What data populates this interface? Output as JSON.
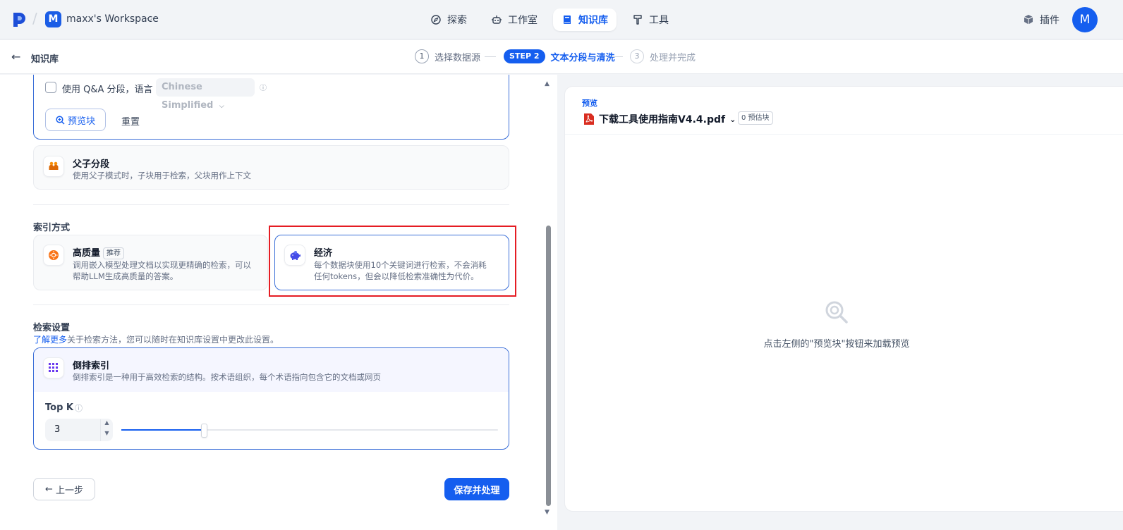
{
  "topnav": {
    "workspace_avatar": "M",
    "workspace_name": "maxx's Workspace",
    "tabs": [
      {
        "label": "探索",
        "icon": "compass-icon"
      },
      {
        "label": "工作室",
        "icon": "robot-icon"
      },
      {
        "label": "知识库",
        "icon": "book-icon",
        "active": true
      },
      {
        "label": "工具",
        "icon": "hammer-icon"
      }
    ],
    "plugin_label": "插件",
    "user_avatar": "M"
  },
  "subheader": {
    "back_label": "知识库",
    "steps": [
      {
        "num": "1",
        "label": "选择数据源",
        "state": "done"
      },
      {
        "num": "STEP 2",
        "label": "文本分段与清洗",
        "state": "current"
      },
      {
        "num": "3",
        "label": "处理并完成",
        "state": "todo"
      }
    ]
  },
  "segmentation": {
    "qa_label": "使用 Q&A 分段，语言",
    "qa_language": "Chinese Simplified",
    "preview_button": "预览块",
    "reset_button": "重置",
    "parent_child": {
      "title": "父子分段",
      "desc": "使用父子模式时，子块用于检索，父块用作上下文"
    }
  },
  "index": {
    "section_title": "索引方式",
    "high_quality": {
      "title": "高质量",
      "badge": "推荐",
      "desc_line1": "调用嵌入模型处理文档以实现更精确的检索，可以",
      "desc_line2": "帮助LLM生成高质量的答案。"
    },
    "economy": {
      "title": "经济",
      "desc_line1": "每个数据块使用10个关键词进行检索，不会消耗",
      "desc_line2": "任何tokens，但会以降低检索准确性为代价。"
    }
  },
  "retrieval": {
    "section_title": "检索设置",
    "learn_more": "了解更多",
    "learn_more_suffix": "关于检索方法，您可以随时在知识库设置中更改此设置。",
    "inverted_index": {
      "title": "倒排索引",
      "desc": "倒排索引是一种用于高效检索的结构。按术语组织，每个术语指向包含它的文档或网页"
    },
    "topk_label": "Top K",
    "topk_value": "3",
    "topk_slider_fraction": 0.22
  },
  "footer": {
    "prev_button": "上一步",
    "save_button": "保存并处理"
  },
  "preview": {
    "label": "预览",
    "file_name": "下载工具使用指南V4.4.pdf",
    "chunk_count": "0 预估块",
    "empty_text": "点击左侧的\"预览块\"按钮来加载预览"
  },
  "colors": {
    "accent": "#155eef",
    "highlight": "#e51c23",
    "pdf_red": "#d92d20"
  }
}
